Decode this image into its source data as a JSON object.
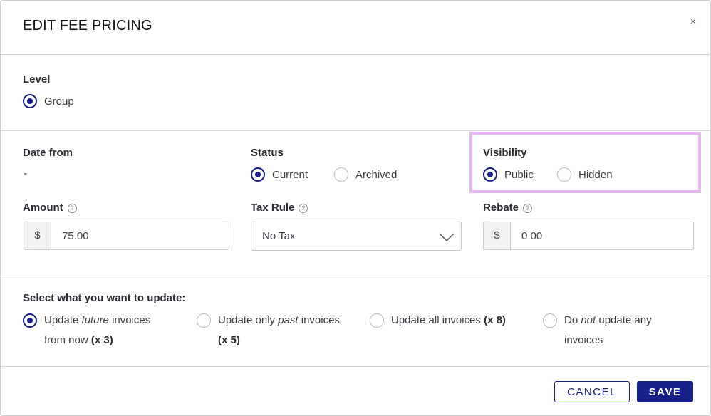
{
  "dialog": {
    "title": "EDIT FEE PRICING",
    "close_glyph": "×"
  },
  "level": {
    "label": "Level",
    "option": "Group",
    "selected": true
  },
  "date_from": {
    "label": "Date from",
    "value": "-"
  },
  "status": {
    "label": "Status",
    "options": [
      "Current",
      "Archived"
    ],
    "selected": "Current"
  },
  "visibility": {
    "label": "Visibility",
    "options": [
      "Public",
      "Hidden"
    ],
    "selected": "Public"
  },
  "amount": {
    "label": "Amount",
    "currency": "$",
    "value": "75.00"
  },
  "tax_rule": {
    "label": "Tax Rule",
    "value": "No Tax"
  },
  "rebate": {
    "label": "Rebate",
    "currency": "$",
    "value": "0.00"
  },
  "help_glyph": "?",
  "update": {
    "label": "Select what you want to update:",
    "options": [
      {
        "pre": "Update ",
        "em": "future",
        "post": " invoices",
        "line2_pre": "from now ",
        "count": "(x 3)",
        "selected": true
      },
      {
        "pre": "Update only ",
        "em": "past",
        "post": " invoices",
        "line2_pre": "",
        "count": "(x 5)",
        "selected": false
      },
      {
        "pre": "Update all invoices ",
        "em": "",
        "post": "",
        "line2_pre": "",
        "count": "(x 8)",
        "selected": false
      },
      {
        "pre": "Do ",
        "em": "not",
        "post": " update any",
        "line2_pre": "invoices",
        "count": "",
        "selected": false
      }
    ]
  },
  "footer": {
    "cancel": "CANCEL",
    "save": "SAVE"
  },
  "colors": {
    "accent": "#171f8a",
    "highlight": "#e6b8f0",
    "border": "#c7c7d0"
  }
}
